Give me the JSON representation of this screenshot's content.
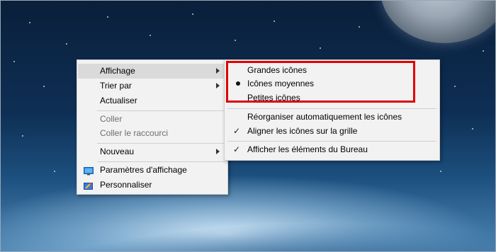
{
  "context_menu": {
    "items": [
      {
        "label": "Affichage"
      },
      {
        "label": "Trier par"
      },
      {
        "label": "Actualiser"
      },
      {
        "label": "Coller"
      },
      {
        "label": "Coller le raccourci"
      },
      {
        "label": "Nouveau"
      },
      {
        "label": "Paramètres d'affichage"
      },
      {
        "label": "Personnaliser"
      }
    ]
  },
  "view_submenu": {
    "items": [
      {
        "label": "Grandes icônes"
      },
      {
        "label": "Icônes moyennes"
      },
      {
        "label": "Petites icônes"
      },
      {
        "label": "Réorganiser automatiquement les icônes"
      },
      {
        "label": "Aligner les icônes sur la grille"
      },
      {
        "label": "Afficher les éléments du Bureau"
      }
    ]
  },
  "colors": {
    "highlight_box": "#e00000",
    "menu_background": "#f2f2f2",
    "hover_background": "#dadada"
  }
}
